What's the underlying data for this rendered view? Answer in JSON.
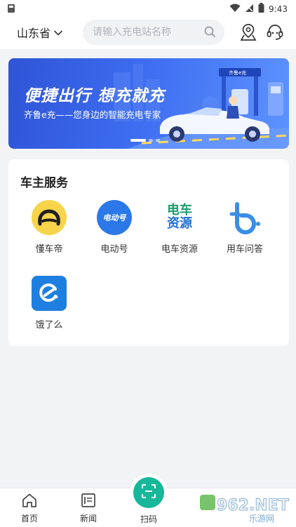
{
  "status_bar": {
    "time": "9:43"
  },
  "header": {
    "province": "山东省",
    "search_placeholder": "请输入充电站名称"
  },
  "banner": {
    "title": "便捷出行  想充就充",
    "subtitle": "齐鲁e充——您身边的智能充电专家",
    "station_sign": "齐鲁e充"
  },
  "services": {
    "title": "车主服务",
    "items": [
      {
        "label": "懂车帝",
        "icon": "dongchedi-icon",
        "color": "#f7d44a"
      },
      {
        "label": "电动号",
        "icon": "diandonghao-icon",
        "color": "#2c78e8",
        "icon_text": "电动号"
      },
      {
        "label": "电车资源",
        "icon": "dianche-ziyuan-icon",
        "color": "#1a9e6b",
        "icon_text_1": "电车",
        "icon_text_2": "资源"
      },
      {
        "label": "用车问答",
        "icon": "yongche-wenda-icon",
        "color": "#3a8ee6"
      },
      {
        "label": "饿了么",
        "icon": "eleme-icon",
        "color": "#1e7fe0"
      }
    ]
  },
  "tabbar": {
    "home": "首页",
    "news": "新闻",
    "scan": "扫码",
    "watermark": "962.NET",
    "watermark_sub": "乐游网"
  },
  "colors": {
    "accent": "#17b79a",
    "banner": "#3d6cf0"
  }
}
